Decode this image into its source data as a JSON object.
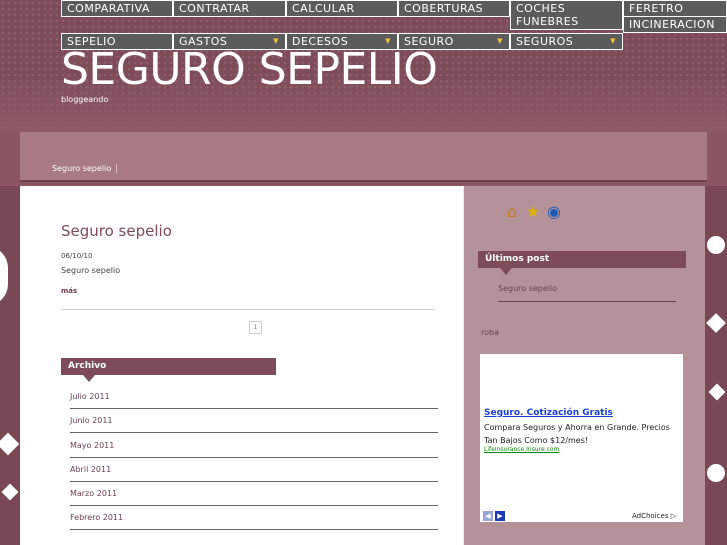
{
  "nav": {
    "row1": [
      "COMPARATIVA",
      "CONTRATAR",
      "CALCULAR",
      "COBERTURAS",
      "COCHES FUNEBRES",
      "FERETRO",
      "INCINERACION"
    ],
    "row2": [
      "SEPELIO",
      "GASTOS",
      "DECESOS",
      "SEGURO",
      "SEGUROS"
    ]
  },
  "blog": {
    "title": "SEGURO SEPELIO",
    "tagline": "bloggeando"
  },
  "breadcrumb": "Seguro sepelio",
  "post": {
    "title": "Seguro sepelio",
    "date": "06/10/10",
    "excerpt": "Seguro sepelio",
    "more": "más"
  },
  "pager": "1",
  "archive": {
    "title": "Archivo",
    "items": [
      "Julio 2011",
      "Junio 2011",
      "Mayo 2011",
      "Abril 2011",
      "Marzo 2011",
      "Febrero 2011"
    ]
  },
  "sidebar": {
    "icons": [
      "home-icon",
      "favorite-icon",
      "homepage-globe-icon"
    ],
    "latest_title": "Últimos post",
    "latest_item": "Seguro sepelio",
    "roba": "roba"
  },
  "ad": {
    "headline": "Seguro. Cotización Gratis",
    "text": "Compara Seguros y Ahorra en Grande. Precios Tan Bajos Como $12/mes!",
    "url": "LifeInsurance.Insure.com",
    "choices": "AdChoices ▷"
  },
  "colors": {
    "brand": "#7e4b58",
    "nav": "#5b5b5b",
    "link": "#1a3fd6"
  }
}
